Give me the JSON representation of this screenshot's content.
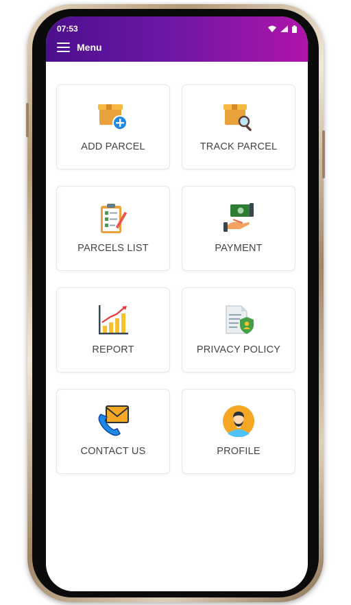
{
  "status": {
    "time": "07:53"
  },
  "header": {
    "title": "Menu"
  },
  "menu": [
    {
      "label": "ADD PARCEL",
      "icon": "add-parcel-icon"
    },
    {
      "label": "TRACK PARCEL",
      "icon": "track-parcel-icon"
    },
    {
      "label": "PARCELS LIST",
      "icon": "clipboard-checklist-icon"
    },
    {
      "label": "PAYMENT",
      "icon": "cash-payment-icon"
    },
    {
      "label": "REPORT",
      "icon": "bar-chart-report-icon"
    },
    {
      "label": "PRIVACY POLICY",
      "icon": "document-shield-icon"
    },
    {
      "label": "CONTACT US",
      "icon": "phone-envelope-icon"
    },
    {
      "label": "PROFILE",
      "icon": "user-avatar-icon"
    }
  ],
  "colors": {
    "header_start": "#4d0f8d",
    "header_end": "#b014aa",
    "label": "#444444"
  }
}
